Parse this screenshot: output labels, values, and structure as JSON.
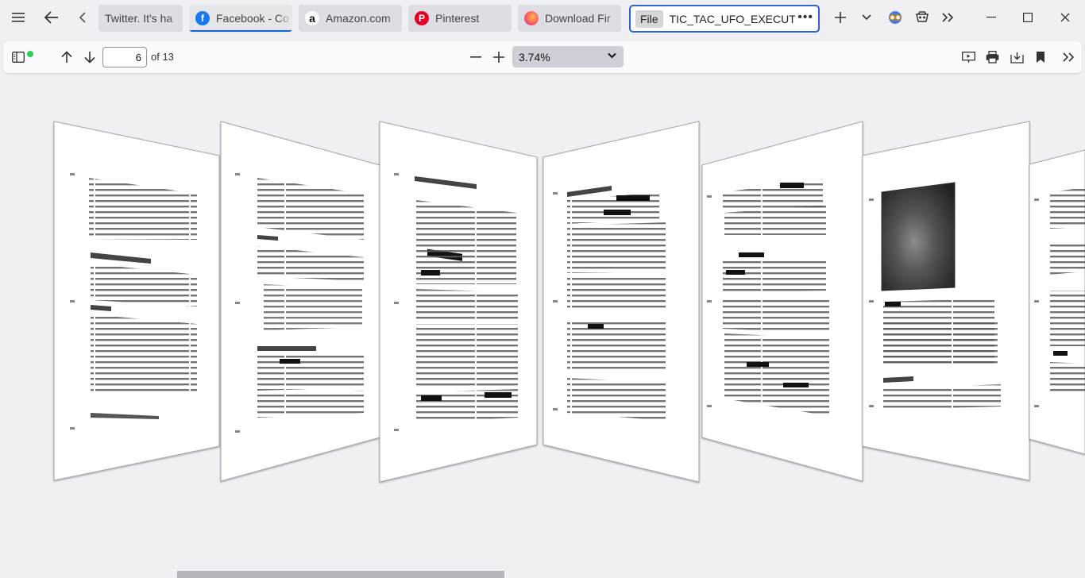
{
  "tabs": [
    {
      "label": "Twitter. It's ha",
      "icon": "twitter-icon"
    },
    {
      "label": "Facebook - Co",
      "icon": "facebook-icon",
      "active": true
    },
    {
      "label": "Amazon.com",
      "icon": "amazon-icon"
    },
    {
      "label": "Pinterest",
      "icon": "pinterest-icon"
    },
    {
      "label": "Download Fir",
      "icon": "firefox-icon"
    }
  ],
  "file_tab": {
    "chip": "File",
    "name": "TIC_TAC_UFO_EXECUTIVE"
  },
  "pdf_toolbar": {
    "page_number": "6",
    "page_count": "of 13",
    "zoom": "3.74%"
  },
  "colors": {
    "accent": "#2a63d3",
    "facebook": "#1877f2",
    "pinterest": "#e60023"
  }
}
